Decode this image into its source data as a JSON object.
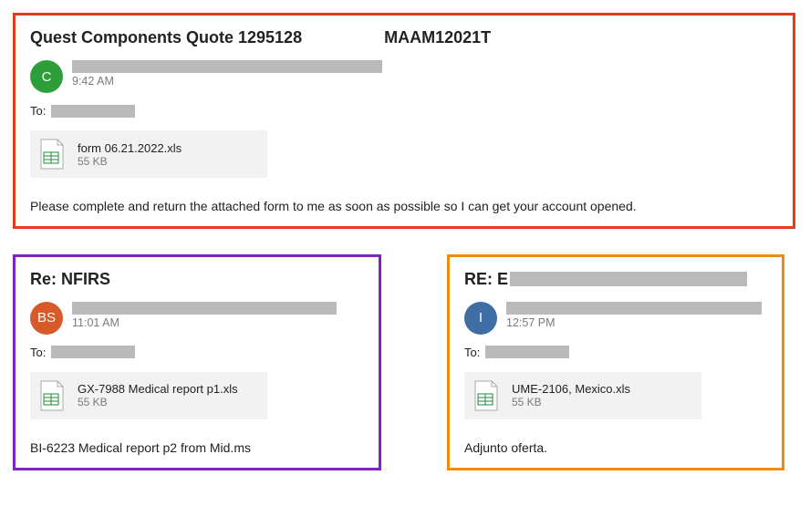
{
  "emails": [
    {
      "subject_prefix": "Quest Components Quote 1295128",
      "subject_suffix": "MAAM12021T",
      "avatar_initials": "C",
      "avatar_color": "avatar-green",
      "timestamp": "9:42 AM",
      "to_label": "To:",
      "attachment_name": "form 06.21.2022.xls",
      "attachment_size": "55 KB",
      "body": "Please complete and return the attached form to me as soon as possible so I can get your account opened."
    },
    {
      "subject_prefix": "Re: NFIRS",
      "avatar_initials": "BS",
      "avatar_color": "avatar-orange",
      "timestamp": "11:01 AM",
      "to_label": "To:",
      "attachment_name": "GX-7988 Medical report p1.xls",
      "attachment_size": "55 KB",
      "body": "BI-6223 Medical report p2 from Mid.ms"
    },
    {
      "subject_prefix": "RE: E",
      "avatar_initials": "I",
      "avatar_color": "avatar-blue",
      "timestamp": "12:57 PM",
      "to_label": "To:",
      "attachment_name": "UME-2106, Mexico.xls",
      "attachment_size": "55 KB",
      "body": "Adjunto oferta."
    }
  ]
}
